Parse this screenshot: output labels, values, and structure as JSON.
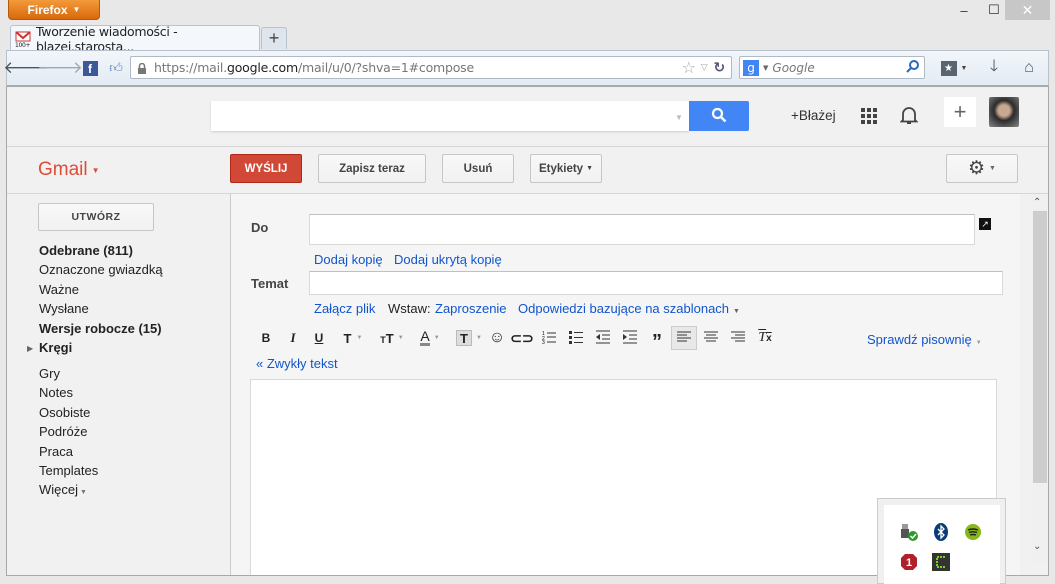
{
  "browser": {
    "menu_label": "Firefox",
    "tab_title": "Tworzenie wiadomości - blazej.starosta...",
    "new_tab_label": "+",
    "url_prefix": "https://mail.",
    "url_domain": "google.com",
    "url_suffix": "/mail/u/0/?shva=1#compose",
    "search_placeholder": "Google",
    "window_controls": {
      "minimize": "‒",
      "maximize": "☐",
      "close": "✕"
    }
  },
  "gmail": {
    "logo": "Gmail",
    "user_link": "+Błażej",
    "search_value": "",
    "toolbar": {
      "send": "WYŚLIJ",
      "save": "Zapisz teraz",
      "delete": "Usuń",
      "labels": "Etykiety"
    },
    "compose_button": "UTWÓRZ",
    "sidebar": {
      "items": [
        {
          "label": "Odebrane (811)",
          "bold": true
        },
        {
          "label": "Oznaczone gwiazdką",
          "bold": false
        },
        {
          "label": "Ważne",
          "bold": false
        },
        {
          "label": "Wysłane",
          "bold": false
        },
        {
          "label": "Wersje robocze (15)",
          "bold": true
        },
        {
          "label": "Kręgi",
          "bold": true
        }
      ],
      "labels": [
        "Gry",
        "Notes",
        "Osobiste",
        "Podróże",
        "Praca",
        "Templates"
      ],
      "more": "Więcej"
    },
    "compose": {
      "to_label": "Do",
      "to_value": "",
      "add_cc": "Dodaj kopię",
      "add_bcc": "Dodaj ukrytą kopię",
      "subject_label": "Temat",
      "subject_value": "",
      "attach": "Załącz plik",
      "insert_label": "Wstaw:",
      "insert_invitation": "Zaproszenie",
      "canned_responses": "Odpowiedzi bazujące na szablonach",
      "spellcheck": "Sprawdź pisownię",
      "plain_text": "« Zwykły tekst",
      "body": ""
    }
  },
  "colors": {
    "send_red": "#d14836",
    "gmail_red": "#dd4b39",
    "link_blue": "#1155cc",
    "search_blue": "#4285f4"
  }
}
